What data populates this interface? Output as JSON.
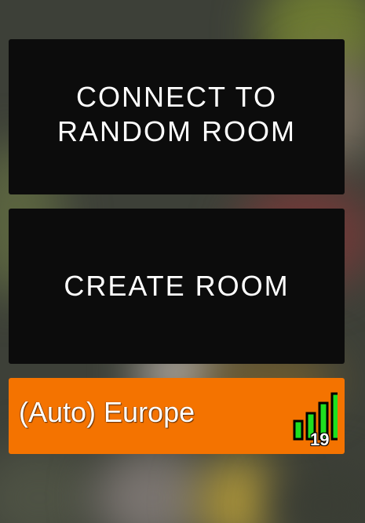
{
  "buttons": {
    "connect_random": "CONNECT TO\nRANDOM ROOM",
    "create_room": "CREATE ROOM"
  },
  "region": {
    "label": "(Auto) Europe",
    "ping": "19",
    "signal_bars_active": 4,
    "signal_bars_total": 4
  },
  "colors": {
    "button_bg": "#0c0c0c",
    "region_bg": "#f47300",
    "signal_green": "#1fe01f",
    "text": "#ffffff"
  }
}
